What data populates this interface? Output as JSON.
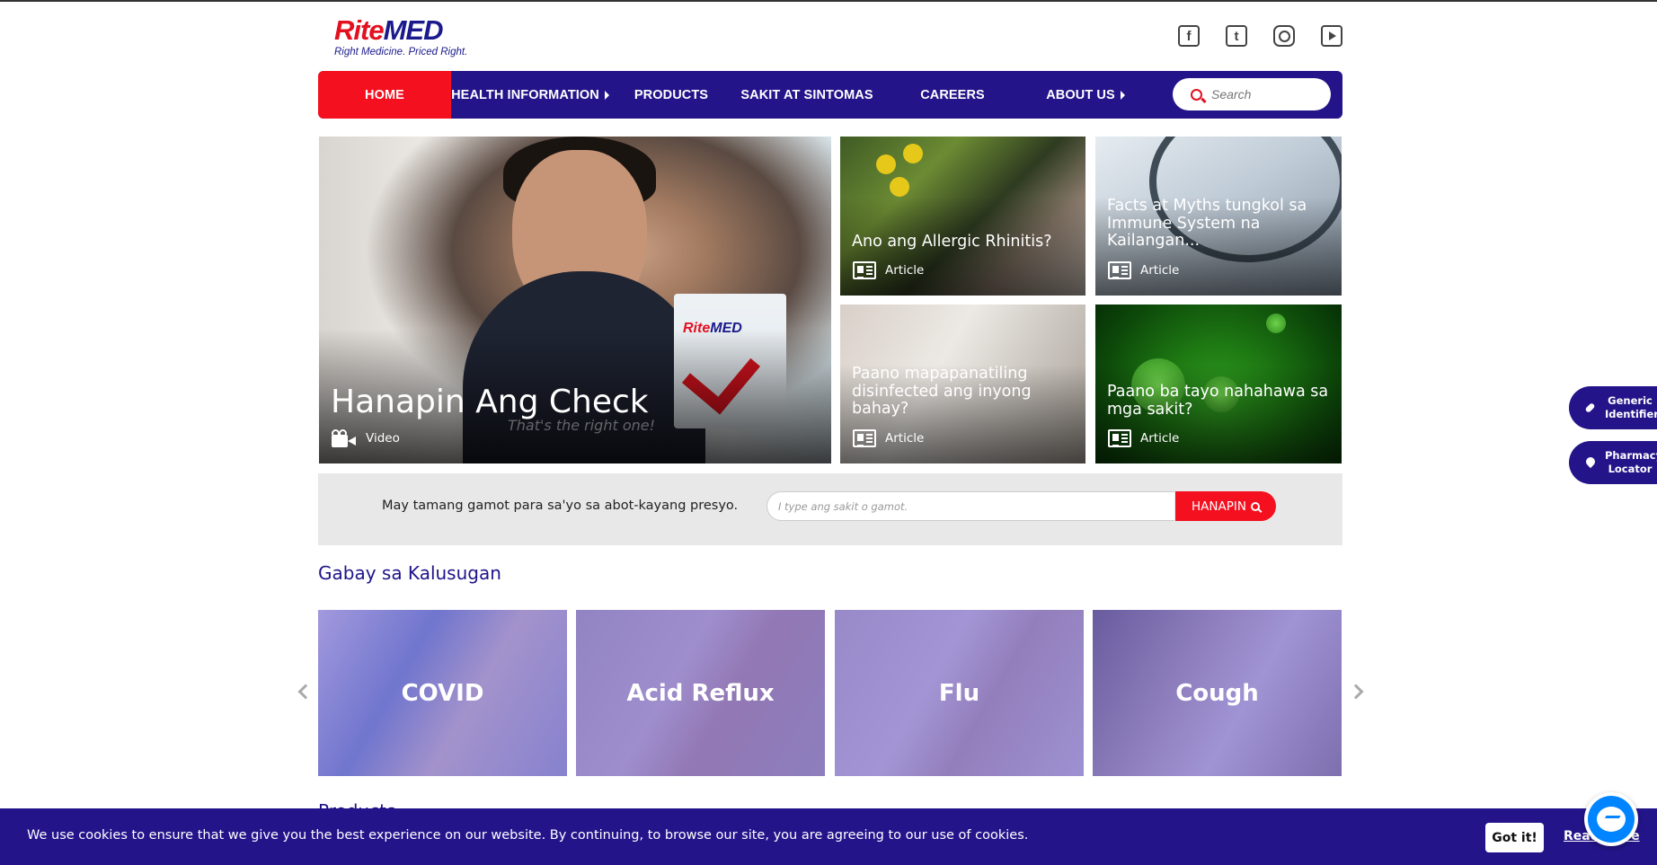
{
  "header": {
    "logo_text": "RiteMED",
    "logo_tagline": "Right Medicine. Priced Right.",
    "socials": [
      "facebook-icon",
      "twitter-icon",
      "instagram-icon",
      "youtube-icon"
    ]
  },
  "nav": {
    "items": [
      {
        "label": "HOME",
        "active": true,
        "has_submenu": false
      },
      {
        "label": "HEALTH INFORMATION",
        "active": false,
        "has_submenu": true
      },
      {
        "label": "PRODUCTS",
        "active": false,
        "has_submenu": false
      },
      {
        "label": "SAKIT AT SINTOMAS",
        "active": false,
        "has_submenu": false
      },
      {
        "label": "CAREERS",
        "active": false,
        "has_submenu": false
      },
      {
        "label": "ABOUT US",
        "active": false,
        "has_submenu": true
      }
    ],
    "search_placeholder": "Search"
  },
  "hero": {
    "main": {
      "title": "Hanapin Ang Check",
      "type": "Video",
      "overlay_text": "That's the right one!"
    },
    "tiles": [
      {
        "title": "Ano ang Allergic Rhinitis?",
        "type": "Article"
      },
      {
        "title": "Facts at Myths tungkol sa Immune System na Kailangan...",
        "type": "Article"
      },
      {
        "title": "Paano mapapanatiling disinfected ang inyong bahay?",
        "type": "Article"
      },
      {
        "title": "Paano ba tayo nahahawa sa mga sakit?",
        "type": "Article"
      }
    ]
  },
  "search_strip": {
    "slogan": "May tamang gamot para sa'yo sa abot-kayang presyo.",
    "placeholder": "I type ang sakit o gamot.",
    "button_label": "HANAPIN"
  },
  "guide": {
    "title": "Gabay sa Kalusugan",
    "cards": [
      "COVID",
      "Acid Reflux",
      "Flu",
      "Cough"
    ]
  },
  "products": {
    "title": "Products"
  },
  "side_buttons": {
    "generic": "Generic Identifier",
    "pharmacy": "Pharmacy Locator"
  },
  "cookie": {
    "message": "We use cookies to ensure that we give you the best experience on our website. By continuing, to browse our site, you are agreeing to our use of cookies.",
    "accept_label": "Got it!",
    "read_more_label": "Read More"
  },
  "colors": {
    "brand_navy": "#23148a",
    "brand_red": "#f4101f"
  }
}
